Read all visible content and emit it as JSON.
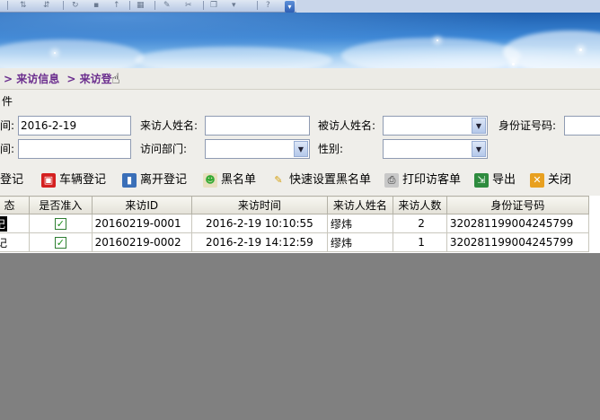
{
  "breadcrumb": {
    "item1": "> 来访信息",
    "item2": "> 来访登"
  },
  "form": {
    "section_label": "件",
    "visit_time_label": "间:",
    "visit_time_value": "2016-2-19",
    "leave_time_label": "间:",
    "leave_time_value": "",
    "visitor_name_label": "来访人姓名:",
    "visitor_name_value": "",
    "visited_person_label": "被访人姓名:",
    "visited_person_value": "",
    "id_number_label": "身份证号码:",
    "id_number_value": "",
    "department_label": "访问部门:",
    "department_value": "",
    "gender_label": "性别:",
    "gender_value": ""
  },
  "toolbar": {
    "register": "登记",
    "vehicle": "车辆登记",
    "leave": "离开登记",
    "blacklist": "黑名单",
    "quick_blacklist": "快速设置黑名单",
    "print": "打印访客单",
    "export": "导出",
    "close": "关闭"
  },
  "table": {
    "headers": [
      "态",
      "是否准入",
      "来访ID",
      "来访时间",
      "来访人姓名",
      "来访人数",
      "身份证号码"
    ],
    "rows": [
      {
        "status": "记",
        "allowed": true,
        "id": "20160219-0001",
        "time": "2016-2-19 10:10:55",
        "name": "缪炜",
        "count": "2",
        "idno": "320281199004245799"
      },
      {
        "status": "记",
        "allowed": true,
        "id": "20160219-0002",
        "time": "2016-2-19 14:12:59",
        "name": "缪炜",
        "count": "1",
        "idno": "320281199004245799"
      }
    ]
  },
  "colors": {
    "breadcrumb": "#6b2e8e",
    "banner": "#3a86d6",
    "background": "#808080"
  }
}
